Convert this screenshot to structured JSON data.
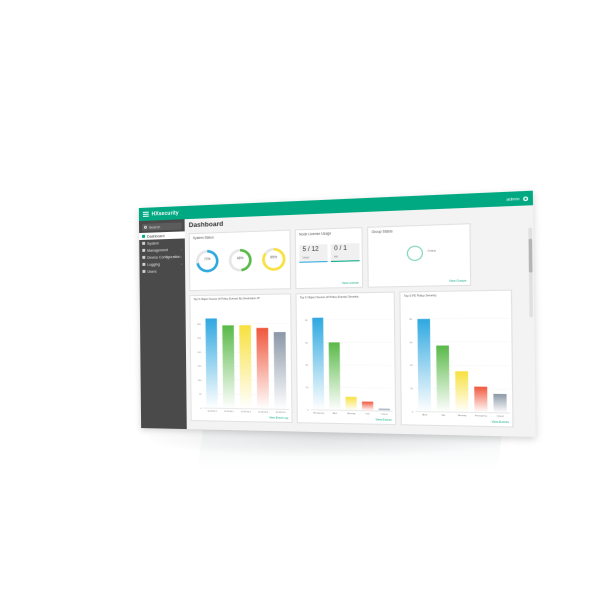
{
  "app": {
    "brand": "HXsecurity",
    "user": "admin",
    "page_title": "Dashboard"
  },
  "colors": {
    "accent": "#01a982",
    "sidebar": "#4a4a4a",
    "blue": "#2ea8e0",
    "green": "#59b947",
    "yellow": "#f7e13e",
    "red": "#f0563c",
    "gray": "#8a97a6"
  },
  "sidebar": {
    "search_placeholder": "Search",
    "items": [
      {
        "label": "Dashboard",
        "icon": "dashboard-icon",
        "active": true
      },
      {
        "label": "System",
        "icon": "system-icon"
      },
      {
        "label": "Management",
        "icon": "management-icon"
      },
      {
        "label": "Device Configuration",
        "icon": "device-config-icon"
      },
      {
        "label": "Logging",
        "icon": "logging-icon"
      },
      {
        "label": "Users",
        "icon": "users-icon"
      }
    ]
  },
  "system_status": {
    "title": "System Status",
    "gauges": [
      {
        "value": "72%",
        "color": "#2ea8e0",
        "level": 0.72
      },
      {
        "value": "48%",
        "color": "#59b947",
        "level": 0.48
      },
      {
        "value": "85%",
        "color": "#f7e13e",
        "level": 0.85
      }
    ]
  },
  "node_license": {
    "title": "Node License Usage",
    "cards": [
      {
        "value": "5 / 12",
        "label": "Used"
      },
      {
        "value": "0 / 1",
        "label": "HA"
      }
    ],
    "link": "View License"
  },
  "group_status": {
    "title": "Group Status",
    "ring_label": "Online",
    "link": "View Groups"
  },
  "charts_meta": {
    "c1_title": "Top 5 Object Source (# Policy Events) By Destination IP",
    "c1_link": "View Event Log",
    "c2_title": "Top 5 Object Source (# Policy Events) Severity",
    "c2_link": "View Events",
    "c3_title": "Top 5 PS Policy Severity",
    "c3_link": "View Events"
  },
  "chart_data": [
    {
      "type": "bar",
      "categories": [
        "10.18.50.1",
        "10.18.50.2",
        "10.18.50.3",
        "10.18.50.4",
        "10.18.50.5"
      ],
      "values": [
        320,
        295,
        295,
        285,
        270
      ],
      "ylim": [
        0,
        350
      ],
      "yticks": [
        "0",
        "50",
        "100",
        "150",
        "200",
        "250",
        "300"
      ]
    },
    {
      "type": "bar",
      "categories": [
        "Emergency",
        "Alert",
        "Warning",
        "Info",
        "Critical"
      ],
      "values": [
        82,
        60,
        12,
        8,
        2
      ],
      "ylim": [
        0,
        90
      ],
      "yticks": [
        "0",
        "20",
        "40",
        "60",
        "80"
      ]
    },
    {
      "type": "bar",
      "categories": [
        "Alert",
        "Info",
        "Warning",
        "Emergency",
        "Critical"
      ],
      "values": [
        80,
        57,
        35,
        22,
        16
      ],
      "ylim": [
        0,
        90
      ],
      "yticks": [
        "0",
        "20",
        "40",
        "60",
        "80"
      ]
    }
  ]
}
